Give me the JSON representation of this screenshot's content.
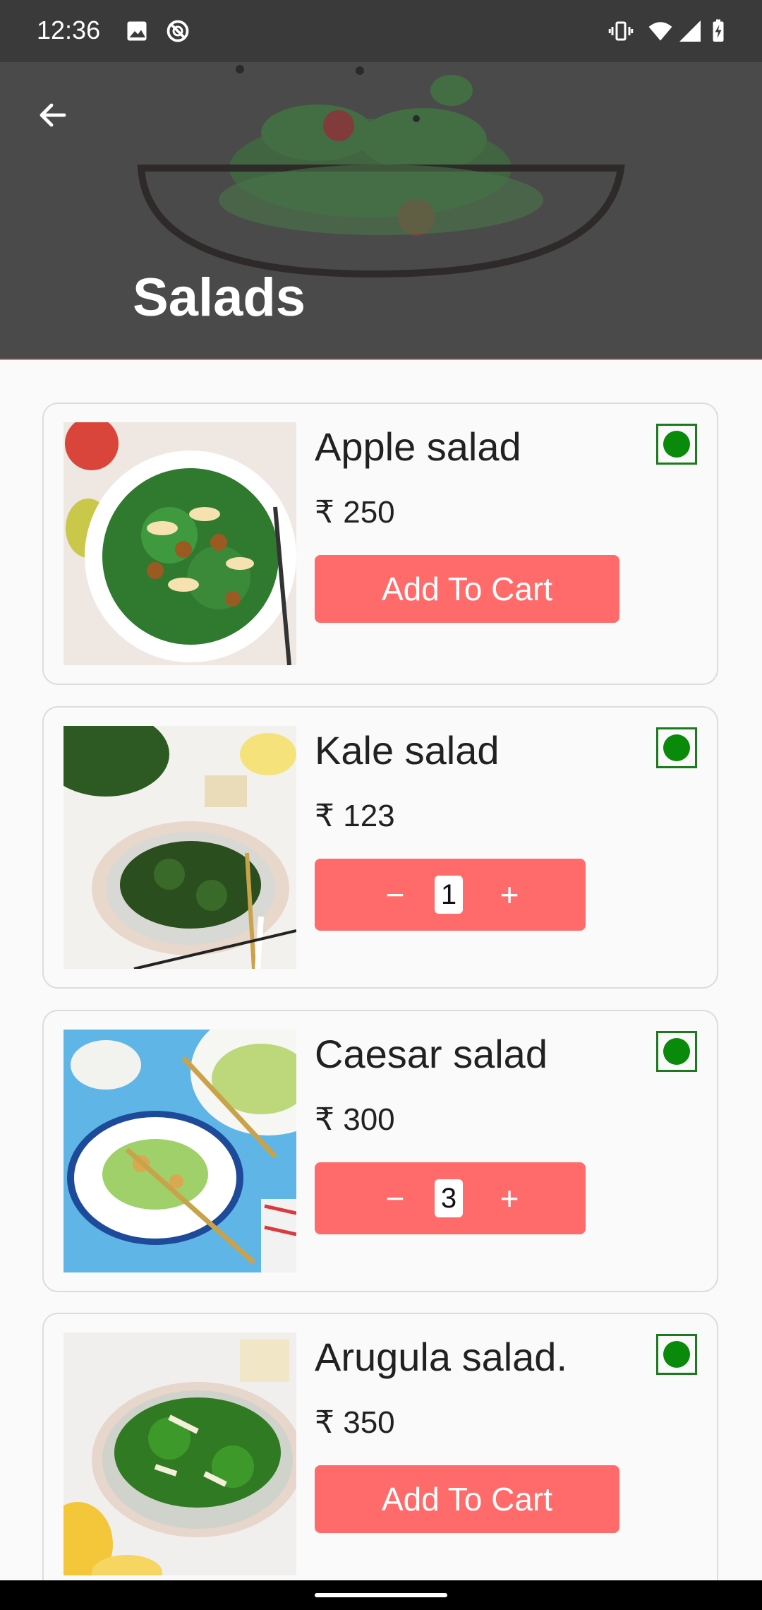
{
  "status_bar": {
    "time": "12:36",
    "left_icons": [
      "image-icon",
      "do-not-disturb-icon"
    ],
    "right_icons": [
      "vibrate-icon",
      "wifi-icon",
      "signal-icon",
      "battery-charging-icon"
    ]
  },
  "header": {
    "title": "Salads",
    "back_icon": "arrow-back-icon"
  },
  "products": [
    {
      "name": "Apple salad",
      "price": "₹ 250",
      "in_cart": false,
      "quantity": null,
      "button_label": "Add To Cart",
      "veg_indicator": true
    },
    {
      "name": "Kale salad",
      "price": "₹ 123",
      "in_cart": true,
      "quantity": "1",
      "button_label": null,
      "veg_indicator": true
    },
    {
      "name": "Caesar salad",
      "price": "₹ 300",
      "in_cart": true,
      "quantity": "3",
      "button_label": null,
      "veg_indicator": true
    },
    {
      "name": "Arugula salad.",
      "price": "₹ 350",
      "in_cart": false,
      "quantity": null,
      "button_label": "Add To Cart",
      "veg_indicator": true
    }
  ],
  "stepper": {
    "minus": "−",
    "plus": "+"
  },
  "colors": {
    "accent": "#ff6b6b",
    "header_bg": "#4a4a4a",
    "status_bar_bg": "#3a3a3a",
    "veg_green": "#0a8a0a"
  }
}
